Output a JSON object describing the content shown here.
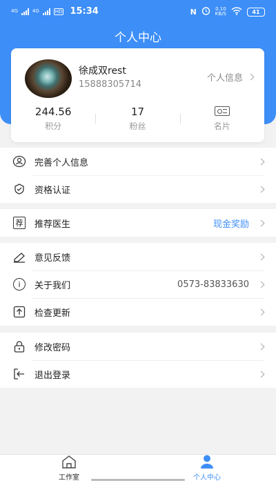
{
  "status_bar": {
    "signal1": "4G",
    "signal2": "4G",
    "hd": "HD",
    "time": "15:34",
    "nfc": "N",
    "speed_value": "0.10",
    "speed_unit": "KB/S",
    "battery": "41"
  },
  "header": {
    "title": "个人中心"
  },
  "profile": {
    "name": "徐成双rest",
    "phone": "15888305714",
    "info_link": "个人信息",
    "stats": [
      {
        "value": "244.56",
        "label": "积分"
      },
      {
        "value": "17",
        "label": "粉丝"
      },
      {
        "label": "名片",
        "icon": "id-card-icon"
      }
    ]
  },
  "menu": {
    "group1": [
      {
        "label": "完善个人信息",
        "icon": "user-icon"
      },
      {
        "label": "资格认证",
        "icon": "certification-icon"
      }
    ],
    "group2": [
      {
        "label": "推荐医生",
        "icon": "recommend-icon",
        "icon_text": "荐",
        "value": "现金奖励"
      }
    ],
    "group3": [
      {
        "label": "意见反馈",
        "icon": "feedback-icon"
      },
      {
        "label": "关于我们",
        "icon": "info-icon",
        "icon_text": "i",
        "value": "0573-83833630"
      },
      {
        "label": "检查更新",
        "icon": "update-icon"
      }
    ],
    "group4": [
      {
        "label": "修改密码",
        "icon": "lock-icon"
      },
      {
        "label": "退出登录",
        "icon": "logout-icon"
      }
    ]
  },
  "tabbar": {
    "tabs": [
      {
        "label": "工作室",
        "icon": "home-icon",
        "active": false
      },
      {
        "label": "个人中心",
        "icon": "person-icon",
        "active": true
      }
    ]
  },
  "colors": {
    "primary": "#3d8ef7",
    "background": "#f2f2f2"
  }
}
